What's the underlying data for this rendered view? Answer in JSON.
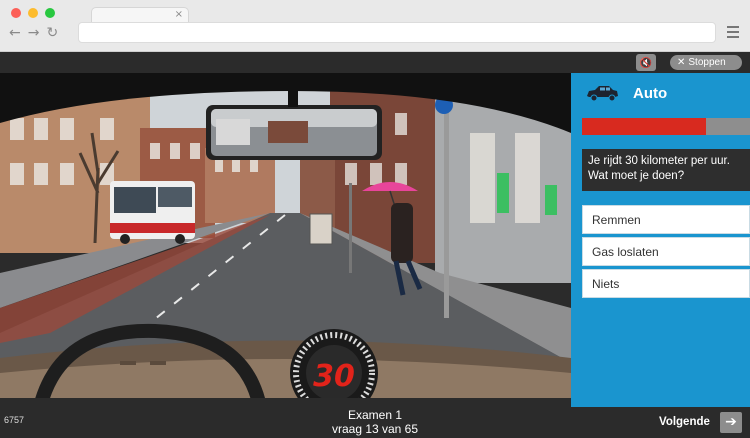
{
  "browser": {
    "tab_close_glyph": "×",
    "back_glyph": "←",
    "forward_glyph": "→",
    "reload_glyph": "↻",
    "dot_colors": [
      "#fc5f57",
      "#fdbc2e",
      "#28c840"
    ]
  },
  "toolbar": {
    "mute_icon": "speaker-muted-icon",
    "mute_glyph": "🔇",
    "stop_glyph": "✕",
    "stop_label": "Stoppen"
  },
  "scene": {
    "speed": "30"
  },
  "panel": {
    "title": "Auto",
    "progress": 0.74,
    "accent_color": "#1a95cf",
    "question": "Je rijdt 30 kilometer per uur. Wat moet je doen?",
    "answers": [
      "Remmen",
      "Gas loslaten",
      "Niets"
    ]
  },
  "footer": {
    "code": "6757",
    "exam_title": "Examen 1",
    "exam_progress": "vraag 13 van 65",
    "next_label": "Volgende",
    "next_glyph": "➔"
  }
}
